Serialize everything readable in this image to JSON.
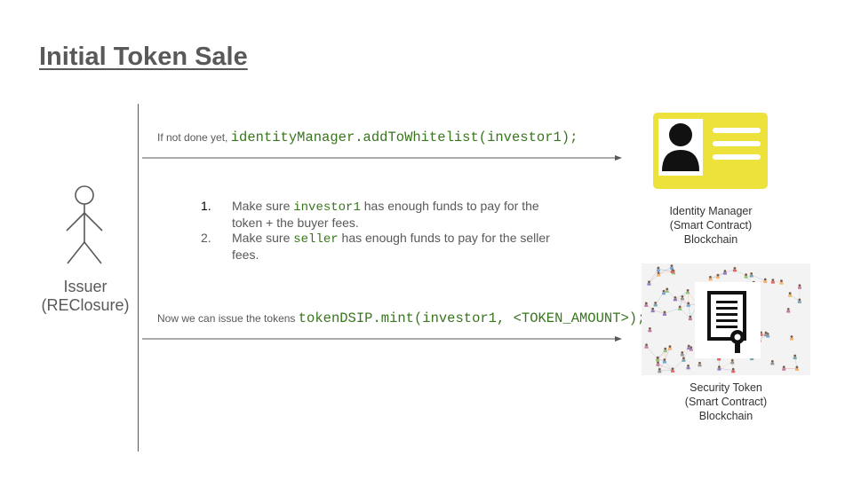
{
  "slide": {
    "title": "Initial Token Sale"
  },
  "actor": {
    "label_line1": "Issuer",
    "label_line2": "(REClosure)"
  },
  "steps": {
    "first": {
      "prefix": "If not done yet, ",
      "code": "identityManager.addToWhitelist(investor1);"
    },
    "list": [
      {
        "num": "1.",
        "pre": "Make sure ",
        "code": "investor1",
        "post": "  has enough funds to pay for the token + the buyer fees."
      },
      {
        "num": "2.",
        "pre": "Make sure ",
        "code": "seller",
        "post": "  has enough funds to pay for the seller fees."
      }
    ],
    "last": {
      "prefix": "Now we can issue the tokens ",
      "code": "tokenDSIP.mint(investor1, <TOKEN_AMOUNT>);"
    }
  },
  "identity_manager": {
    "line1": "Identity Manager",
    "line2": "(Smart Contract)",
    "line3": "Blockchain",
    "icon": "id-card-icon",
    "card_color": "#ede13b"
  },
  "security_token": {
    "line1": "Security Token",
    "line2": "(Smart Contract)",
    "line3": "Blockchain",
    "icon": "document-certificate-icon"
  },
  "colors": {
    "text": "#595959",
    "code": "#38761d",
    "card": "#ede13b"
  }
}
